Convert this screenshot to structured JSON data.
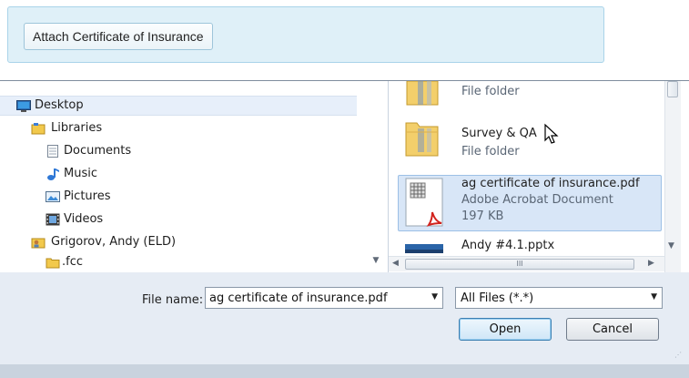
{
  "web": {
    "attach_button": "Attach Certificate of Insurance"
  },
  "nav": {
    "items": [
      {
        "label": "Desktop",
        "icon": "desktop-icon"
      },
      {
        "label": "Libraries",
        "icon": "libraries-icon"
      },
      {
        "label": "Documents",
        "icon": "documents-icon"
      },
      {
        "label": "Music",
        "icon": "music-icon"
      },
      {
        "label": "Pictures",
        "icon": "pictures-icon"
      },
      {
        "label": "Videos",
        "icon": "videos-icon"
      },
      {
        "label": "Grigorov, Andy (ELD)",
        "icon": "user-folder-icon"
      },
      {
        "label": ".fcc",
        "icon": "folder-icon"
      }
    ]
  },
  "files": {
    "items": [
      {
        "name": "",
        "type": "File folder",
        "icon": "folder-icon"
      },
      {
        "name": "Survey & QA",
        "type": "File folder",
        "icon": "folder-icon"
      },
      {
        "name": "ag certificate of insurance.pdf",
        "type": "Adobe Acrobat Document",
        "size": "197 KB",
        "icon": "pdf-icon"
      },
      {
        "name": "Andy #4.1.pptx",
        "type": "",
        "icon": "pptx-icon"
      }
    ],
    "hscroll_glyph": "III"
  },
  "form": {
    "file_name_label": "File name:",
    "file_name_value": "ag certificate of insurance.pdf",
    "filter_value": "All Files (*.*)",
    "open_label": "Open",
    "cancel_label": "Cancel"
  },
  "colors": {
    "panel_bg": "#dff0f8",
    "selection": "#d8e6f7",
    "dialog_bg": "#e6ecf4"
  }
}
